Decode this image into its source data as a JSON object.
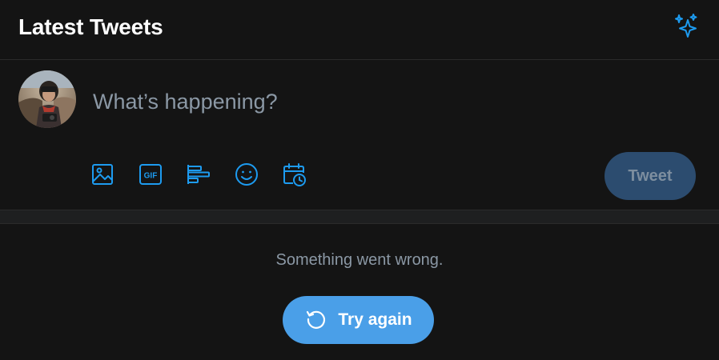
{
  "header": {
    "title": "Latest Tweets",
    "sparkle_icon": "sparkle-icon"
  },
  "composer": {
    "placeholder": "What’s happening?",
    "toolbar": [
      {
        "icon": "image-icon"
      },
      {
        "icon": "gif-icon",
        "text": "GIF"
      },
      {
        "icon": "poll-icon"
      },
      {
        "icon": "emoji-icon"
      },
      {
        "icon": "schedule-icon"
      }
    ],
    "tweet_label": "Tweet"
  },
  "error": {
    "message": "Something went wrong.",
    "retry_label": "Try again",
    "retry_icon": "refresh-icon"
  },
  "colors": {
    "accent": "#1da1f2",
    "retry_bg": "#4a9fe8",
    "tweet_disabled_bg": "#2c4c6f",
    "muted_text": "#8b98a5",
    "background": "#141414"
  }
}
